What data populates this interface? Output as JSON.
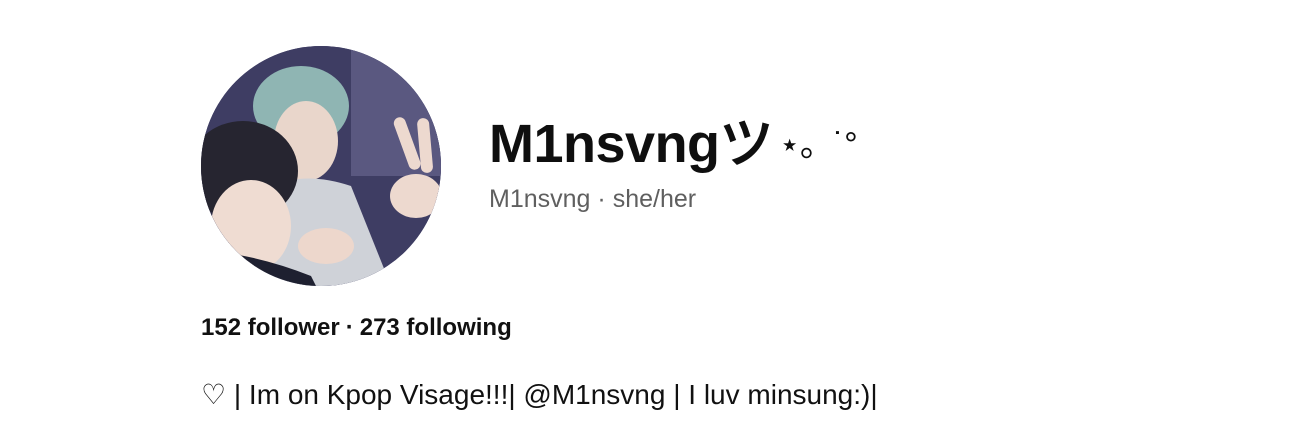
{
  "profile": {
    "display_name": "M1nsvngツ",
    "display_name_decoration": "⋆。˙°",
    "username": "M1nsvng",
    "pronouns": "she/her",
    "subline_separator": "·",
    "followers": "152 follower",
    "following": "273 following",
    "stats_separator": "·",
    "bio": "♡ | Im on Kpop Visage!!!| @M1nsvng | I luv minsung:)|"
  },
  "colors": {
    "text_primary": "#111111",
    "text_secondary": "#5f5f5f",
    "background": "#ffffff"
  },
  "icons": {
    "avatar": "profile-photo"
  }
}
